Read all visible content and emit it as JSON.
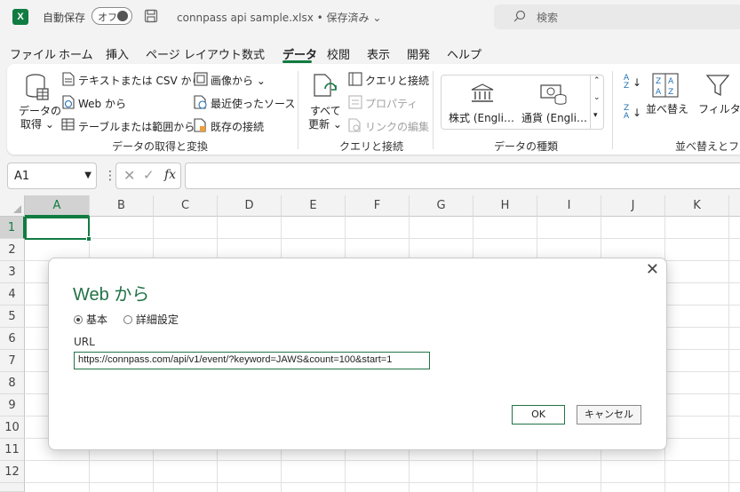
{
  "titlebar": {
    "app_logo": "X",
    "autosave_label": "自動保存",
    "autosave_toggle": "オフ",
    "file_title": "connpass api sample.xlsx • 保存済み ⌄",
    "search_placeholder": "検索"
  },
  "menu": {
    "items": [
      "ファイル",
      "ホーム",
      "挿入",
      "ページ レイアウト",
      "数式",
      "データ",
      "校閲",
      "表示",
      "開発",
      "ヘルプ"
    ],
    "active": "データ"
  },
  "ribbon": {
    "get_data": {
      "label_line1": "データの",
      "label_line2": "取得 ⌄"
    },
    "from_text_csv": "テキストまたは CSV から",
    "from_web": "Web から",
    "from_table": "テーブルまたは範囲から",
    "from_image": "画像から ⌄",
    "recent_sources": "最近使ったソース",
    "existing_connections": "既存の接続",
    "group_get_transform": "データの取得と変換",
    "refresh_all": {
      "label_line1": "すべて",
      "label_line2": "更新 ⌄"
    },
    "queries_connections": "クエリと接続",
    "properties": "プロパティ",
    "edit_links": "リンクの編集",
    "group_queries": "クエリと接続",
    "stocks": "株式 (Engli…",
    "currencies": "通貨 (Engli…",
    "group_data_types": "データの種類",
    "sort_label": "並べ替え",
    "filter_label": "フィルター",
    "group_sort_filter": "並べ替えとフィル"
  },
  "formula_bar": {
    "name_box": "A1",
    "fx": "fx",
    "formula": ""
  },
  "grid": {
    "columns": [
      "A",
      "B",
      "C",
      "D",
      "E",
      "F",
      "G",
      "H",
      "I",
      "J",
      "K"
    ],
    "rows": [
      "1",
      "2",
      "3",
      "4",
      "5",
      "6",
      "7",
      "8",
      "9",
      "10",
      "11",
      "12"
    ],
    "selected_cell": "A1"
  },
  "dialog": {
    "title": "Web から",
    "radio_basic": "基本",
    "radio_advanced": "詳細設定",
    "url_label": "URL",
    "url_value": "https://connpass.com/api/v1/event/?keyword=JAWS&count=100&start=1",
    "ok_label": "OK",
    "cancel_label": "キャンセル"
  }
}
